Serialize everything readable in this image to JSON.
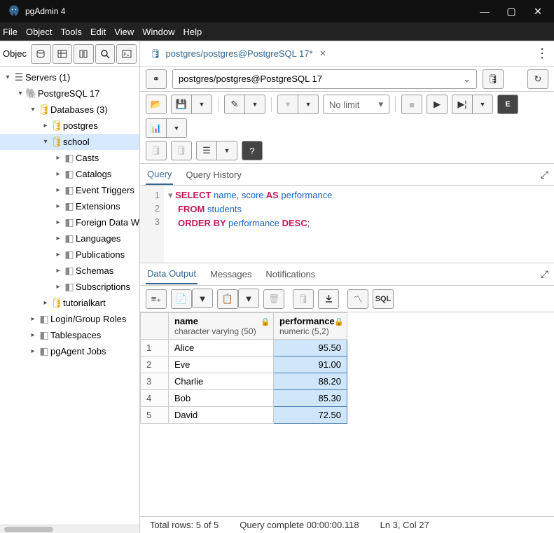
{
  "window": {
    "title": "pgAdmin 4"
  },
  "menu": [
    "File",
    "Object",
    "Tools",
    "Edit",
    "View",
    "Window",
    "Help"
  ],
  "sidebar": {
    "header": "Objec",
    "tree": {
      "servers": "Servers (1)",
      "pg": "PostgreSQL 17",
      "databases": "Databases (3)",
      "postgres": "postgres",
      "school": "school",
      "school_children": [
        "Casts",
        "Catalogs",
        "Event Triggers",
        "Extensions",
        "Foreign Data W",
        "Languages",
        "Publications",
        "Schemas",
        "Subscriptions"
      ],
      "tutorial": "tutorialkart",
      "others": [
        "Login/Group Roles",
        "Tablespaces",
        "pgAgent Jobs"
      ]
    }
  },
  "maintab": {
    "label": "postgres/postgres@PostgreSQL 17*"
  },
  "connection": {
    "value": "postgres/postgres@PostgreSQL 17"
  },
  "limit": "No limit",
  "editor_tabs": {
    "query": "Query",
    "history": "Query History"
  },
  "sql": {
    "lines": [
      "1",
      "2",
      "3"
    ],
    "l1a": "SELECT",
    "l1b": " name",
    "l1c": ", ",
    "l1d": "score",
    "l1e": " AS ",
    "l1f": "performance",
    "l2a": "FROM",
    "l2b": " students",
    "l3a": "ORDER",
    "l3b": " BY ",
    "l3c": "performance",
    "l3d": " DESC",
    "l3e": ";"
  },
  "output_tabs": {
    "data": "Data Output",
    "messages": "Messages",
    "notifications": "Notifications"
  },
  "sql_btn": "SQL",
  "columns": [
    {
      "name": "name",
      "type": "character varying (50)"
    },
    {
      "name": "performance",
      "type": "numeric (5,2)"
    }
  ],
  "rows": [
    {
      "n": "1",
      "name": "Alice",
      "perf": "95.50"
    },
    {
      "n": "2",
      "name": "Eve",
      "perf": "91.00"
    },
    {
      "n": "3",
      "name": "Charlie",
      "perf": "88.20"
    },
    {
      "n": "4",
      "name": "Bob",
      "perf": "85.30"
    },
    {
      "n": "5",
      "name": "David",
      "perf": "72.50"
    }
  ],
  "status": {
    "rows": "Total rows: 5 of 5",
    "time": "Query complete 00:00:00.118",
    "pos": "Ln 3, Col 27"
  }
}
